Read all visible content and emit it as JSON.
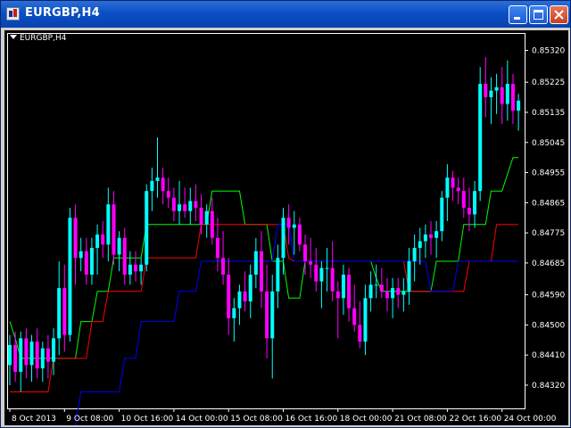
{
  "window": {
    "title": "EURGBP,H4",
    "icons": {
      "app": "chart-app-icon",
      "minimize": "minimize-icon",
      "maximize": "maximize-icon",
      "close": "close-icon"
    }
  },
  "chart": {
    "symbol_label": "EURGBP,H4",
    "menu_icon": "triangle-down-icon"
  },
  "colors": {
    "background": "#000000",
    "grid": "#ffffff",
    "bull_candle": "#00ffff",
    "bear_candle": "#ff00ff",
    "line_green": "#00ff00",
    "line_red": "#ff0000",
    "line_blue": "#0000ff",
    "title_bar": "#0a4fc4"
  },
  "chart_data": {
    "type": "candlestick",
    "title": "EURGBP,H4",
    "ylim": [
      0.842,
      0.8538
    ],
    "y_ticks": [
      "0.85320",
      "0.85225",
      "0.85135",
      "0.85045",
      "0.84955",
      "0.84865",
      "0.84775",
      "0.84685",
      "0.84590",
      "0.84500",
      "0.84410",
      "0.84320",
      "0.84230"
    ],
    "y_tick_values": [
      0.8532,
      0.85225,
      0.85135,
      0.85045,
      0.84955,
      0.84865,
      0.84775,
      0.84685,
      0.8459,
      0.845,
      0.8441,
      0.8432,
      0.8423
    ],
    "x_ticks": [
      "8 Oct 2013",
      "9 Oct 08:00",
      "10 Oct 16:00",
      "14 Oct 00:00",
      "15 Oct 08:00",
      "16 Oct 16:00",
      "18 Oct 00:00",
      "21 Oct 08:00",
      "22 Oct 16:00",
      "24 Oct 00:00"
    ],
    "x_tick_bars": [
      0,
      10,
      20,
      30,
      40,
      50,
      60,
      70,
      80,
      90
    ],
    "candles": [
      [
        0.8438,
        0.8447,
        0.8432,
        0.8444
      ],
      [
        0.8444,
        0.8448,
        0.8433,
        0.8436
      ],
      [
        0.8436,
        0.8448,
        0.843,
        0.8446
      ],
      [
        0.8446,
        0.8449,
        0.8434,
        0.8438
      ],
      [
        0.8438,
        0.8447,
        0.8433,
        0.8445
      ],
      [
        0.8445,
        0.8449,
        0.8434,
        0.8437
      ],
      [
        0.8437,
        0.8445,
        0.8433,
        0.8443
      ],
      [
        0.8443,
        0.8447,
        0.8434,
        0.8439
      ],
      [
        0.8439,
        0.8449,
        0.8435,
        0.8446
      ],
      [
        0.8446,
        0.8469,
        0.8441,
        0.8461
      ],
      [
        0.8461,
        0.8468,
        0.8442,
        0.8447
      ],
      [
        0.8447,
        0.8485,
        0.8445,
        0.8482
      ],
      [
        0.8482,
        0.8486,
        0.8462,
        0.847
      ],
      [
        0.847,
        0.8476,
        0.8466,
        0.8472
      ],
      [
        0.8472,
        0.8476,
        0.8462,
        0.8465
      ],
      [
        0.8465,
        0.8476,
        0.8462,
        0.8473
      ],
      [
        0.8473,
        0.848,
        0.8465,
        0.8477
      ],
      [
        0.8477,
        0.8481,
        0.847,
        0.8474
      ],
      [
        0.8474,
        0.8491,
        0.8469,
        0.8486
      ],
      [
        0.8486,
        0.849,
        0.8468,
        0.8471
      ],
      [
        0.8471,
        0.8478,
        0.8466,
        0.8476
      ],
      [
        0.8476,
        0.8479,
        0.8462,
        0.8465
      ],
      [
        0.8465,
        0.8472,
        0.8462,
        0.8468
      ],
      [
        0.8468,
        0.8472,
        0.8463,
        0.8466
      ],
      [
        0.8466,
        0.847,
        0.8462,
        0.8468
      ],
      [
        0.8468,
        0.8492,
        0.8466,
        0.849
      ],
      [
        0.849,
        0.8497,
        0.8484,
        0.8493
      ],
      [
        0.8493,
        0.8506,
        0.8488,
        0.8494
      ],
      [
        0.8494,
        0.8497,
        0.8486,
        0.849
      ],
      [
        0.849,
        0.8494,
        0.8485,
        0.8488
      ],
      [
        0.8488,
        0.8491,
        0.8481,
        0.8484
      ],
      [
        0.8484,
        0.8493,
        0.848,
        0.8486
      ],
      [
        0.8486,
        0.8491,
        0.8482,
        0.8484
      ],
      [
        0.8484,
        0.8491,
        0.848,
        0.8487
      ],
      [
        0.8487,
        0.8492,
        0.8481,
        0.8485
      ],
      [
        0.8485,
        0.8489,
        0.8477,
        0.848
      ],
      [
        0.848,
        0.8486,
        0.8476,
        0.8484
      ],
      [
        0.8484,
        0.8488,
        0.8474,
        0.8476
      ],
      [
        0.8476,
        0.8482,
        0.8466,
        0.847
      ],
      [
        0.847,
        0.8478,
        0.8462,
        0.8465
      ],
      [
        0.8465,
        0.847,
        0.8447,
        0.8452
      ],
      [
        0.8452,
        0.8458,
        0.8445,
        0.8455
      ],
      [
        0.8455,
        0.8462,
        0.845,
        0.846
      ],
      [
        0.846,
        0.8466,
        0.8454,
        0.8457
      ],
      [
        0.8457,
        0.8468,
        0.8452,
        0.8465
      ],
      [
        0.8465,
        0.8476,
        0.8461,
        0.8472
      ],
      [
        0.8472,
        0.8478,
        0.8455,
        0.846
      ],
      [
        0.846,
        0.8468,
        0.844,
        0.8446
      ],
      [
        0.8446,
        0.8465,
        0.8434,
        0.846
      ],
      [
        0.846,
        0.8474,
        0.8455,
        0.847
      ],
      [
        0.847,
        0.8485,
        0.8465,
        0.8482
      ],
      [
        0.8482,
        0.8486,
        0.8474,
        0.8479
      ],
      [
        0.8479,
        0.8484,
        0.8471,
        0.848
      ],
      [
        0.848,
        0.8482,
        0.8472,
        0.8474
      ],
      [
        0.8474,
        0.8477,
        0.8465,
        0.8469
      ],
      [
        0.8469,
        0.8476,
        0.8464,
        0.8468
      ],
      [
        0.8468,
        0.8473,
        0.846,
        0.8463
      ],
      [
        0.8463,
        0.8469,
        0.8455,
        0.8467
      ],
      [
        0.8467,
        0.8473,
        0.846,
        0.8467
      ],
      [
        0.8467,
        0.8475,
        0.8457,
        0.846
      ],
      [
        0.846,
        0.8463,
        0.8446,
        0.8458
      ],
      [
        0.8458,
        0.8468,
        0.8453,
        0.8465
      ],
      [
        0.8465,
        0.8467,
        0.8451,
        0.8455
      ],
      [
        0.8455,
        0.8462,
        0.8448,
        0.845
      ],
      [
        0.845,
        0.8457,
        0.8443,
        0.8445
      ],
      [
        0.8445,
        0.8462,
        0.8441,
        0.8458
      ],
      [
        0.8458,
        0.8466,
        0.8454,
        0.8462
      ],
      [
        0.8462,
        0.8468,
        0.8458,
        0.8462
      ],
      [
        0.8462,
        0.8467,
        0.8458,
        0.846
      ],
      [
        0.846,
        0.8464,
        0.8454,
        0.8458
      ],
      [
        0.8458,
        0.8464,
        0.8452,
        0.8461
      ],
      [
        0.8461,
        0.8464,
        0.8455,
        0.8459
      ],
      [
        0.8459,
        0.8464,
        0.8454,
        0.846
      ],
      [
        0.846,
        0.8473,
        0.8456,
        0.8469
      ],
      [
        0.8469,
        0.8477,
        0.8463,
        0.8473
      ],
      [
        0.8473,
        0.8479,
        0.8468,
        0.8475
      ],
      [
        0.8475,
        0.848,
        0.847,
        0.8477
      ],
      [
        0.8477,
        0.8481,
        0.8471,
        0.8476
      ],
      [
        0.8476,
        0.8481,
        0.847,
        0.8478
      ],
      [
        0.8478,
        0.849,
        0.8475,
        0.8488
      ],
      [
        0.8488,
        0.8498,
        0.8481,
        0.8494
      ],
      [
        0.8494,
        0.8496,
        0.8487,
        0.8491
      ],
      [
        0.8491,
        0.8494,
        0.8486,
        0.849
      ],
      [
        0.849,
        0.8494,
        0.8482,
        0.8485
      ],
      [
        0.8485,
        0.8491,
        0.8478,
        0.8483
      ],
      [
        0.8483,
        0.8493,
        0.8479,
        0.849
      ],
      [
        0.849,
        0.8527,
        0.8487,
        0.8522
      ],
      [
        0.8522,
        0.853,
        0.8512,
        0.8518
      ],
      [
        0.8518,
        0.8524,
        0.851,
        0.852
      ],
      [
        0.852,
        0.8525,
        0.8513,
        0.8521
      ],
      [
        0.8521,
        0.8527,
        0.851,
        0.8516
      ],
      [
        0.8516,
        0.8529,
        0.8511,
        0.8522
      ],
      [
        0.8522,
        0.8525,
        0.851,
        0.8514
      ],
      [
        0.8514,
        0.8519,
        0.8508,
        0.8517
      ]
    ],
    "series": [
      {
        "color": "#00ff00",
        "values": [
          0.8451,
          0.8446,
          0.844,
          0.844,
          0.844,
          0.844,
          0.844,
          0.844,
          0.844,
          0.844,
          0.844,
          0.844,
          0.844,
          0.8451,
          0.8451,
          0.8451,
          0.846,
          0.846,
          0.846,
          0.847,
          0.847,
          0.847,
          0.847,
          0.847,
          0.847,
          0.848,
          0.848,
          0.848,
          0.848,
          0.848,
          0.848,
          0.848,
          0.848,
          0.848,
          0.848,
          0.848,
          0.848,
          0.849,
          0.849,
          0.849,
          0.849,
          0.849,
          0.849,
          0.848,
          0.848,
          0.848,
          0.848,
          0.848,
          0.8469,
          0.8469,
          0.8469,
          0.8458,
          0.8458,
          0.8458,
          0.8469,
          0.8469,
          0.8469,
          0.8469,
          0.8469,
          0.8469,
          0.8469,
          0.8469,
          0.8469,
          0.8469,
          0.8469,
          0.8469,
          0.8469,
          0.8464,
          0.846,
          0.846,
          0.846,
          0.846,
          0.846,
          0.846,
          0.846,
          0.846,
          0.846,
          0.846,
          0.8469,
          0.8469,
          0.8469,
          0.8469,
          0.8469,
          0.848,
          0.848,
          0.848,
          0.848,
          0.848,
          0.849,
          0.849,
          0.849,
          0.8495,
          0.85,
          0.85
        ]
      },
      {
        "color": "#ff0000",
        "values": [
          0.843,
          0.843,
          0.843,
          0.843,
          0.843,
          0.843,
          0.843,
          0.843,
          0.844,
          0.844,
          0.844,
          0.844,
          0.844,
          0.844,
          0.844,
          0.8451,
          0.8451,
          0.8451,
          0.846,
          0.846,
          0.846,
          0.846,
          0.846,
          0.846,
          0.846,
          0.847,
          0.847,
          0.847,
          0.847,
          0.847,
          0.847,
          0.847,
          0.847,
          0.847,
          0.847,
          0.848,
          0.848,
          0.848,
          0.848,
          0.848,
          0.848,
          0.848,
          0.848,
          0.848,
          0.848,
          0.848,
          0.848,
          0.848,
          0.848,
          0.848,
          0.848,
          0.847,
          0.8469,
          0.8469,
          0.8469,
          0.8469,
          0.8469,
          0.8469,
          0.8469,
          0.8469,
          0.8469,
          0.8469,
          0.8469,
          0.8469,
          0.8469,
          0.8469,
          0.8469,
          0.8469,
          0.8469,
          0.8469,
          0.8469,
          0.8469,
          0.8469,
          0.846,
          0.846,
          0.846,
          0.846,
          0.846,
          0.846,
          0.846,
          0.846,
          0.846,
          0.846,
          0.846,
          0.8469,
          0.8469,
          0.8469,
          0.8469,
          0.8469,
          0.848,
          0.848,
          0.848,
          0.848,
          0.848
        ]
      },
      {
        "color": "#0000ff",
        "values": [
          null,
          null,
          null,
          null,
          null,
          null,
          null,
          null,
          null,
          null,
          null,
          null,
          0.842,
          0.843,
          0.843,
          0.843,
          0.843,
          0.843,
          0.843,
          0.843,
          0.843,
          0.844,
          0.844,
          0.844,
          0.8451,
          0.8451,
          0.8451,
          0.8451,
          0.8451,
          0.8451,
          0.8451,
          0.846,
          0.846,
          0.846,
          0.846,
          0.8469,
          0.8469,
          0.8469,
          0.8469,
          0.8469,
          0.8469,
          0.8469,
          0.8469,
          0.8469,
          0.8469,
          0.8469,
          0.8469,
          0.8469,
          0.8469,
          0.848,
          0.848,
          0.848,
          0.8469,
          0.8469,
          0.8469,
          0.8469,
          0.8469,
          0.8469,
          0.8469,
          0.8469,
          0.8469,
          0.8469,
          0.8469,
          0.8469,
          0.8469,
          0.8469,
          0.8469,
          0.8469,
          0.8469,
          0.8469,
          0.8469,
          0.8469,
          0.8469,
          0.8469,
          0.8469,
          0.8469,
          0.8469,
          0.846,
          0.846,
          0.846,
          0.846,
          0.846,
          0.8469,
          0.8469,
          0.8469,
          0.8469,
          0.8469,
          0.8469,
          0.8469,
          0.8469,
          0.8469,
          0.8469,
          0.8469,
          0.8469
        ]
      }
    ],
    "grid": false,
    "legend": "none"
  }
}
